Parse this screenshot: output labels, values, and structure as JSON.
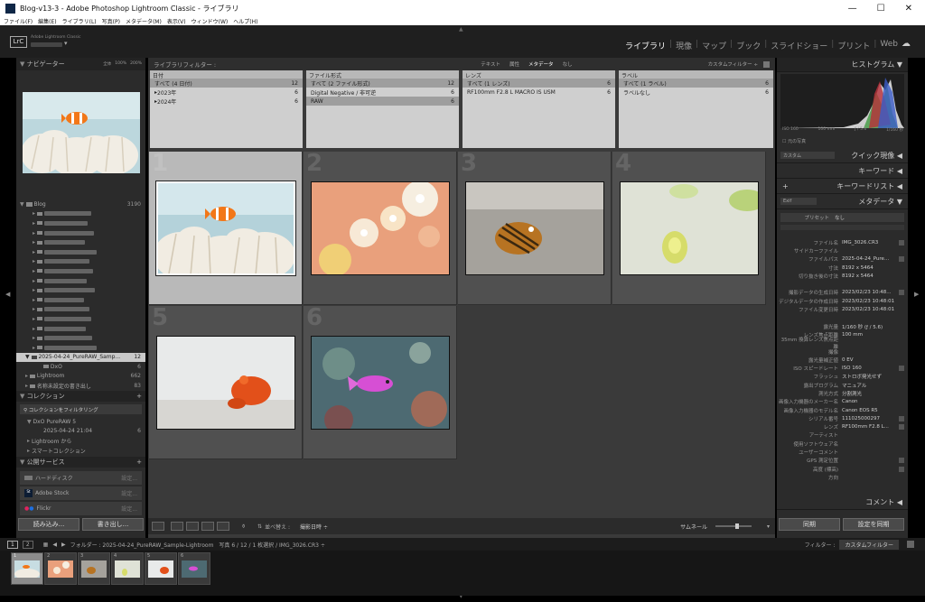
{
  "window": {
    "title": "Blog-v13-3 - Adobe Photoshop Lightroom Classic - ライブラリ"
  },
  "menu": [
    "ファイル(F)",
    "編集(E)",
    "ライブラリ(L)",
    "写真(P)",
    "メタデータ(M)",
    "表示(V)",
    "ウィンドウ(W)",
    "ヘルプ(H)"
  ],
  "brand": {
    "badge": "LrC",
    "line1": "Adobe Lightroom Classic"
  },
  "modules": [
    "ライブラリ",
    "現像",
    "マップ",
    "ブック",
    "スライドショー",
    "プリント",
    "Web"
  ],
  "navigator": {
    "title": "ナビゲーター",
    "zoom": [
      "全体",
      "100%",
      "200%"
    ]
  },
  "folders": {
    "blog_label": "Blog",
    "blog_count": "3190",
    "selected_label": "2025-04-24_PureRAW_Samp...",
    "selected_count": "12",
    "dxo_label": "DxO",
    "dxo_count": "6",
    "lightroom_label": "Lightroom",
    "lightroom_count": "662",
    "noname_label": "名称未設定の書き出し",
    "noname_count": "83"
  },
  "collections": {
    "title": "コレクション",
    "filter": "コレクションをフィルタリング",
    "items": [
      "DxO PureRAW 5",
      "2025-04-24 21:04",
      "Lightroom から",
      "スマートコレクション"
    ],
    "item_count": "6"
  },
  "publish": {
    "title": "公開サービス",
    "items": [
      {
        "label": "ハードディスク",
        "action": "設定..."
      },
      {
        "label": "Adobe Stock",
        "action": "設定..."
      },
      {
        "label": "Flickr",
        "action": "設定..."
      }
    ],
    "import": "読み込み...",
    "export": "書き出し..."
  },
  "filter_bar": {
    "title": "ライブラリフィルター :",
    "tabs": [
      "テキスト",
      "属性",
      "メタデータ",
      "なし"
    ],
    "custom": "カスタムフィルター ÷"
  },
  "filter_cols": [
    {
      "header": "日付",
      "rows": [
        {
          "label": "すべて (4 日付)",
          "count": "12"
        },
        {
          "label": "2023年",
          "count": "6"
        },
        {
          "label": "2024年",
          "count": "6"
        }
      ]
    },
    {
      "header": "ファイル形式",
      "rows": [
        {
          "label": "すべて (2 ファイル形式)",
          "count": "12"
        },
        {
          "label": "Digital Negative / 非可逆",
          "count": "6"
        },
        {
          "label": "RAW",
          "count": "6"
        }
      ]
    },
    {
      "header": "レンズ",
      "rows": [
        {
          "label": "すべて (1 レンズ)",
          "count": "6"
        },
        {
          "label": "RF100mm F2.8 L MACRO IS USM",
          "count": "6"
        }
      ]
    },
    {
      "header": "ラベル",
      "rows": [
        {
          "label": "すべて (1 ラベル)",
          "count": "6"
        },
        {
          "label": "ラベルなし",
          "count": "6"
        }
      ]
    }
  ],
  "grid_numbers": [
    "1",
    "2",
    "3",
    "4",
    "5",
    "6"
  ],
  "toolbar": {
    "sort_label": "並べ替え :",
    "sort_value": "撮影日時 ÷",
    "thumb_label": "サムネール"
  },
  "histogram": {
    "title": "ヒストグラム",
    "iso": "ISO 160",
    "focal": "100 mm",
    "aperture": "ƒ / 5.6",
    "shutter": "1/160 秒",
    "original": "元の写真"
  },
  "quick": {
    "preset": "カスタム",
    "title": "クイック現像"
  },
  "keyword": {
    "title": "キーワード",
    "list": "キーワードリスト"
  },
  "metadata": {
    "title": "メタデータ",
    "mode": "Exif",
    "preset_label": "プリセット",
    "preset_value": "なし",
    "rows": [
      {
        "k": "ファイル名",
        "v": "IMG_3026.CR3"
      },
      {
        "k": "サイドカーファイル",
        "v": ""
      },
      {
        "k": "ファイルパス",
        "v": "2025-04-24_Pure..."
      },
      {
        "k": "寸法",
        "v": "8192 x 5464"
      },
      {
        "k": "切り抜き後の寸法",
        "v": "8192 x 5464"
      },
      {
        "k": "",
        "v": ""
      },
      {
        "k": "撮影データの生成日時",
        "v": "2023/02/23 10:48..."
      },
      {
        "k": "デジタルデータの作成日時",
        "v": "2023/02/23 10:48:01"
      },
      {
        "k": "ファイル変更日時",
        "v": "2023/02/23 10:48:01"
      },
      {
        "k": "",
        "v": ""
      },
      {
        "k": "露光量",
        "v": "1/160 秒 (ƒ / 5.6)"
      },
      {
        "k": "レンズ焦点距離",
        "v": "100 mm"
      },
      {
        "k": "35mm 換算レンズ焦点距離",
        "v": ""
      },
      {
        "k": "撮像",
        "v": ""
      },
      {
        "k": "露光量補正値",
        "v": "0 EV"
      },
      {
        "k": "ISO スピードレート",
        "v": "ISO 160"
      },
      {
        "k": "フラッシュ",
        "v": "ストロボ発光せず"
      },
      {
        "k": "露出プログラム",
        "v": "マニュアル"
      },
      {
        "k": "測光方式",
        "v": "分割測光"
      },
      {
        "k": "画像入力機器のメーカー名",
        "v": "Canon"
      },
      {
        "k": "画像入力機器のモデル名",
        "v": "Canon EOS R5"
      },
      {
        "k": "シリアル番号",
        "v": "111025000297"
      },
      {
        "k": "レンズ",
        "v": "RF100mm F2.8 L..."
      },
      {
        "k": "アーティスト",
        "v": ""
      },
      {
        "k": "使用ソフトウェア名",
        "v": ""
      },
      {
        "k": "ユーザーコメント",
        "v": ""
      },
      {
        "k": "GPS 測定位置",
        "v": ""
      },
      {
        "k": "高度 (標高)",
        "v": ""
      },
      {
        "k": "方向",
        "v": ""
      }
    ]
  },
  "comments": {
    "title": "コメント"
  },
  "sync": {
    "sync_btn": "同期",
    "settings_btn": "設定を同期"
  },
  "filmstrip": {
    "page1": "1",
    "page2": "2",
    "path": "フォルダー : 2025-04-24_PureRAW_Sample-Lightroom　写真 6 / 12 / 1 枚選択 / IMG_3026.CR3 ÷",
    "filter_label": "フィルター :",
    "filter_value": "カスタムフィルター",
    "thumb_numbers": [
      "1",
      "2",
      "3",
      "4",
      "5",
      "6"
    ]
  },
  "colors": {
    "bg": "#2b2b2b",
    "panel_header": "#232323",
    "grid_cell": "#505050",
    "selected_cell": "#b9b9b9"
  }
}
